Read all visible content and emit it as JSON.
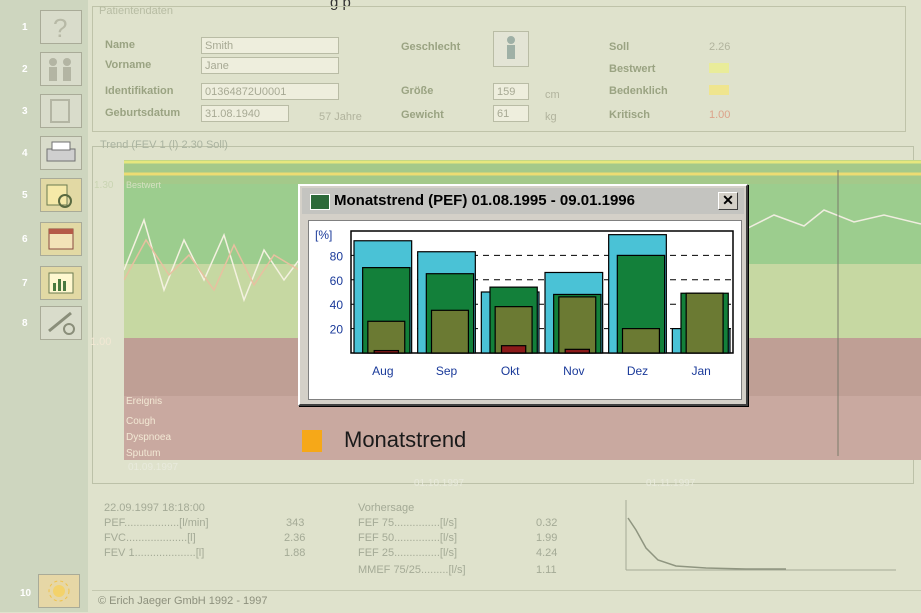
{
  "page_fragment": "g      p",
  "toolbar": {
    "numbers": [
      "1",
      "2",
      "3",
      "4",
      "5",
      "6",
      "7",
      "8",
      "10"
    ]
  },
  "patient": {
    "section_title": "Patientendaten",
    "name_label": "Name",
    "name_value": "Smith",
    "vorname_label": "Vorname",
    "vorname_value": "Jane",
    "id_label": "Identifikation",
    "id_value": "01364872U0001",
    "geb_label": "Geburtsdatum",
    "geb_value": "31.08.1940",
    "age": "57 Jahre",
    "geschlecht_label": "Geschlecht",
    "groesse_label": "Größe",
    "groesse_value": "159",
    "groesse_unit": "cm",
    "gewicht_label": "Gewicht",
    "gewicht_value": "61",
    "gewicht_unit": "kg",
    "soll_label": "Soll",
    "soll_value": "2.26",
    "bestwert_label": "Bestwert",
    "bestwert_value": "",
    "bedenklich_label": "Bedenklich",
    "bedenklich_value": "",
    "kritisch_label": "Kritisch",
    "kritisch_value": "1.00"
  },
  "trend": {
    "title": "Trend (FEV 1 (l) 2.30 Soll)",
    "level_top": "1.30",
    "level_top_tag": "Bestwert",
    "level_low": "1.00",
    "band_labels": [
      "Ereignis",
      "Cough",
      "Dyspnoea",
      "Sputum"
    ],
    "dates": [
      "01.09.1997",
      "01.10.1997",
      "01.11.1997"
    ]
  },
  "dialog": {
    "title": "Monatstrend (PEF) 01.08.1995 - 09.01.1996",
    "close_label": "✕"
  },
  "chart_data": {
    "type": "bar",
    "title": "Monatstrend (PEF) 01.08.1995 - 09.01.1996",
    "ylabel": "[%]",
    "ylim": [
      0,
      100
    ],
    "yticks": [
      20,
      40,
      60,
      80
    ],
    "categories": [
      "Aug",
      "Sep",
      "Okt",
      "Nov",
      "Dez",
      "Jan"
    ],
    "series": [
      {
        "values": [
          92,
          83,
          50,
          66,
          97,
          20
        ],
        "color": "#4ac2d6"
      },
      {
        "values": [
          70,
          65,
          54,
          48,
          80,
          49
        ],
        "color": "#13803a"
      },
      {
        "values": [
          26,
          35,
          38,
          46,
          20,
          49
        ],
        "color": "#6b7a33"
      },
      {
        "values": [
          2,
          0,
          6,
          3,
          0,
          0
        ],
        "color": "#8b1a1a"
      }
    ],
    "grid": "horizontal dashed"
  },
  "legend": {
    "label": "Monatstrend",
    "color": "#f6a818"
  },
  "stats": {
    "datetime": "22.09.1997 18:18:00",
    "left": [
      {
        "label": "PEF..................[l/min]",
        "value": "343"
      },
      {
        "label": "FVC....................[l]",
        "value": "2.36"
      },
      {
        "label": "FEV 1....................[l]",
        "value": "1.88"
      }
    ],
    "vorhersage_title": "Vorhersage",
    "right": [
      {
        "label": "FEF 75...............[l/s]",
        "value": "0.32"
      },
      {
        "label": "FEF 50...............[l/s]",
        "value": "1.99"
      },
      {
        "label": "FEF 25...............[l/s]",
        "value": "4.24"
      },
      {
        "label": "MMEF 75/25.........[l/s]",
        "value": "1.11"
      }
    ]
  },
  "footer": "© Erich Jaeger GmbH 1992 - 1997"
}
